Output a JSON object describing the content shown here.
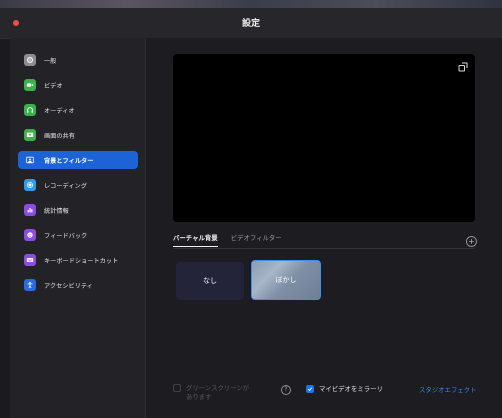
{
  "window": {
    "title": "設定"
  },
  "colors": {
    "accent": "#1d63d8",
    "close": "#ef4d47",
    "link": "#3a86f4"
  },
  "sidebar": {
    "items": [
      {
        "label": "一般",
        "icon": "gear-icon",
        "color": "#8d8d93",
        "active": false
      },
      {
        "label": "ビデオ",
        "icon": "video-camera-icon",
        "color": "#38b24b",
        "active": false
      },
      {
        "label": "オーディオ",
        "icon": "headphones-icon",
        "color": "#38b24b",
        "active": false
      },
      {
        "label": "画面の共有",
        "icon": "screen-share-icon",
        "color": "#38b24b",
        "active": false
      },
      {
        "label": "背景とフィルター",
        "icon": "person-background-icon",
        "color": "#1d63d8",
        "active": true
      },
      {
        "label": "レコーディング",
        "icon": "record-icon",
        "color": "#2b9cf0",
        "active": false
      },
      {
        "label": "統計情報",
        "icon": "bar-chart-icon",
        "color": "#8e4be0",
        "active": false
      },
      {
        "label": "フィードバック",
        "icon": "smiley-icon",
        "color": "#8e4be0",
        "active": false
      },
      {
        "label": "キーボードショートカット",
        "icon": "keyboard-icon",
        "color": "#8e4be0",
        "active": false
      },
      {
        "label": "アクセシビリティ",
        "icon": "accessibility-icon",
        "color": "#2b6be0",
        "active": false
      }
    ]
  },
  "main": {
    "tabs": [
      {
        "label": "バーチャル背景",
        "active": true
      },
      {
        "label": "ビデオフィルター",
        "active": false
      }
    ],
    "backgrounds": [
      {
        "label": "なし",
        "selected": false
      },
      {
        "label": "ぼかし",
        "selected": true
      }
    ],
    "green_screen": {
      "label": "グリーンスクリーンがあります",
      "checked": false,
      "enabled": false
    },
    "mirror": {
      "label": "マイビデオをミラーリ",
      "checked": true
    },
    "studio_effects_label": "スタジオエフェクト"
  }
}
